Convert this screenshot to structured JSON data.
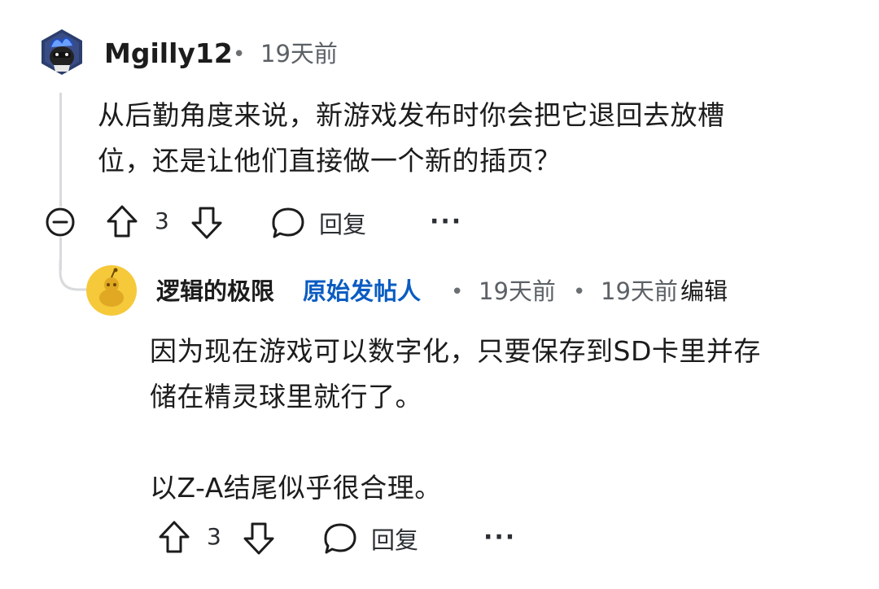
{
  "comment1": {
    "username": "Mgilly12",
    "separator": "•",
    "time": "19天前",
    "text_line1": "从后勤角度来说，新游戏发布时你会把它退回去放槽",
    "text_line2": "位，还是让他们直接做一个新的插页？",
    "votes": "3",
    "reply_label": "回复",
    "more_label": "···"
  },
  "comment2": {
    "username": "逻辑的极限",
    "op_badge": "原始发帖人",
    "separator1": "•",
    "time": "19天前",
    "separator2": "•",
    "edited_time": "19天前",
    "edited_label": "编辑",
    "text_line1": "因为现在游戏可以数字化，只要保存到SD卡里并存",
    "text_line2": "储在精灵球里就行了。",
    "text_line3": "以Z-A结尾似乎很合理。",
    "votes": "3",
    "reply_label": "回复",
    "more_label": "···"
  },
  "colors": {
    "op_badge": "#0a5cc2",
    "thread_line": "#d8dadc",
    "snoo_avatar_bg": "#f5c93a"
  }
}
